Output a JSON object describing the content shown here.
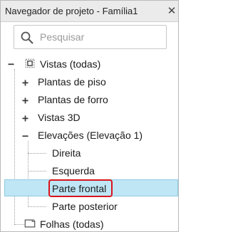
{
  "panel": {
    "title": "Navegador de projeto - Família1",
    "close_glyph": "✕"
  },
  "search": {
    "placeholder": "Pesquisar",
    "value": ""
  },
  "tree": {
    "root": {
      "label": "Vistas (todas)",
      "icon": "views-icon",
      "expanded": true
    },
    "items": [
      {
        "label": "Plantas de piso",
        "expander": "+"
      },
      {
        "label": "Plantas de forro",
        "expander": "+"
      },
      {
        "label": "Vistas 3D",
        "expander": "+"
      },
      {
        "label": "Elevações (Elevação 1)",
        "expander": "−"
      }
    ],
    "elevations": [
      {
        "label": "Direita"
      },
      {
        "label": "Esquerda"
      },
      {
        "label": "Parte frontal",
        "selected": true
      },
      {
        "label": "Parte posterior"
      }
    ],
    "sheets": {
      "label": "Folhas (todas)",
      "icon": "sheet-icon"
    },
    "root_expander": "−"
  },
  "colors": {
    "selection_fill": "#bfe6f5",
    "highlight_outline": "#d9141b"
  }
}
